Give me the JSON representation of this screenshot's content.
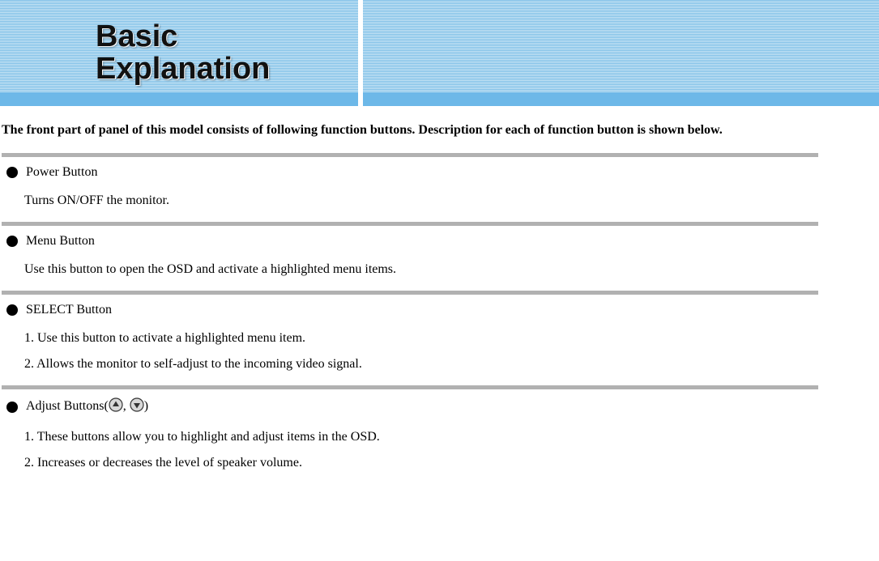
{
  "header": {
    "line1": "Basic",
    "line2": "Explanation"
  },
  "intro": "The front part of panel of this model consists of following function buttons. Description for each of function button is shown below.",
  "sections": {
    "power": {
      "title": "Power Button",
      "body": "Turns ON/OFF the monitor."
    },
    "menu": {
      "title": "Menu Button",
      "body": "Use this button to open the OSD and activate a highlighted menu items."
    },
    "select": {
      "title": "SELECT Button",
      "line1": "1. Use this button to activate a highlighted menu item.",
      "line2": "2. Allows the monitor to self-adjust to the incoming video signal."
    },
    "adjust": {
      "title_prefix": "Adjust Buttons(",
      "title_sep": ", ",
      "title_suffix": ")",
      "line1": "1. These buttons allow you to highlight and adjust items in the OSD.",
      "line2": "2. Increases or decreases the level of speaker volume."
    }
  }
}
